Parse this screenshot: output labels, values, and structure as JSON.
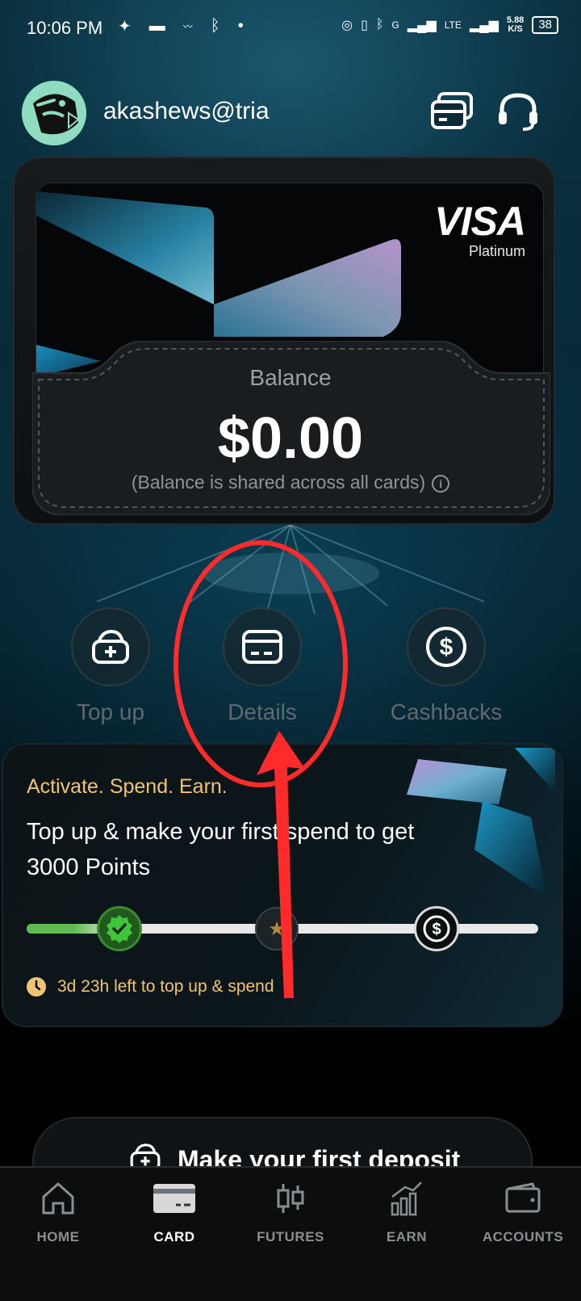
{
  "status_bar": {
    "time": "10:06 PM",
    "network": "G",
    "lte": "LTE",
    "speed": "5.88",
    "speed_unit": "K/S",
    "battery": "38"
  },
  "header": {
    "username": "akashews@tria",
    "icons": [
      "cards-icon",
      "headset-icon"
    ]
  },
  "card": {
    "brand": "VISA",
    "tier": "Platinum",
    "balance_label": "Balance",
    "balance_amount": "$0.00",
    "balance_note": "(Balance is shared across all cards)"
  },
  "actions": [
    {
      "label": "Top up",
      "icon": "wallet-plus-icon"
    },
    {
      "label": "Details",
      "icon": "card-icon"
    },
    {
      "label": "Cashbacks",
      "icon": "dollar-icon"
    }
  ],
  "promo": {
    "kicker": "Activate. Spend. Earn.",
    "title": "Top up & make your first spend to get 3000 Points",
    "timer": "3d 23h left to top up & spend",
    "progress": 0.18
  },
  "deposit": {
    "label": "Make your first deposit"
  },
  "nav": [
    {
      "label": "HOME",
      "icon": "home-icon",
      "active": false
    },
    {
      "label": "CARD",
      "icon": "card-icon",
      "active": true
    },
    {
      "label": "FUTURES",
      "icon": "candlestick-icon",
      "active": false
    },
    {
      "label": "EARN",
      "icon": "bar-chart-icon",
      "active": false
    },
    {
      "label": "ACCOUNTS",
      "icon": "wallet-icon",
      "active": false
    }
  ],
  "colors": {
    "accent_gold": "#f0c470",
    "progress_green": "#5dbb4f",
    "annotation_red": "#ff2a2a"
  }
}
